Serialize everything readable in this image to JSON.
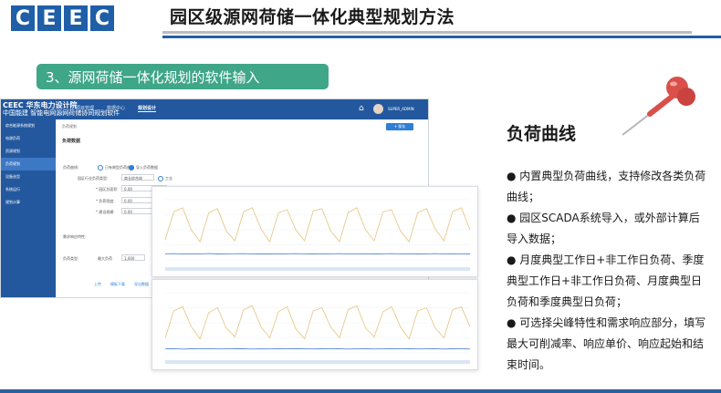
{
  "header": {
    "logo_letters": [
      "C",
      "E",
      "E",
      "C"
    ],
    "title": "园区级源网荷储一体化典型规划方法"
  },
  "section": {
    "label": "3、源网荷储一体化规划的软件输入"
  },
  "app": {
    "brand_line1": "CEEC 华东电力设计院",
    "brand_line2": "中国能建 智能电网源网荷储协同规划软件",
    "tabs": [
      "项目管理",
      "数据中心",
      "规划设计"
    ],
    "active_tab": 2,
    "user": "SUPER_ADMIN",
    "sidebar": [
      "综合能源系统规划",
      "电源负荷",
      "资源规划",
      "负荷规划",
      "设备选型",
      "系统运行",
      "规划计算"
    ],
    "active_sidebar": 3,
    "breadcrumb": "负荷规划",
    "action_button": "+ 保存",
    "panel_title": "负荷数据",
    "rows": [
      {
        "label": "负荷曲线:",
        "value": "已有典型负荷曲线",
        "value2": "导入负荷数据"
      },
      {
        "label": "园区行业负荷类型:",
        "value": "商业综合体",
        "value2": "工业"
      },
      {
        "label": "* 园区总面积:",
        "value": "0.00"
      },
      {
        "label": "* 负荷密度:",
        "value": "0.00"
      },
      {
        "label": "* 建设规模:",
        "value": "0.00"
      }
    ],
    "subsection1": "需求响应特性:",
    "subsection2": "负荷类型:",
    "max_label": "最大负荷",
    "max_value": "1,000",
    "links": [
      "上传",
      "模板下载",
      "导出数据"
    ]
  },
  "bullets": {
    "title": "负荷曲线",
    "items": [
      "内置典型负荷曲线，支持修改各类负荷曲线；",
      "园区SCADA系统导入，或外部计算后导入数据；",
      "月度典型工作日+非工作日负荷、季度典型工作日+非工作日负荷、月度典型日负荷和季度典型日负荷；",
      "可选择尖峰特性和需求响应部分，填写最大可削减率、响应单价、响应起始和结束时间。"
    ]
  },
  "colors": {
    "accent_blue": "#1f5fa8",
    "badge_green": "#3fa687",
    "curve_load": "#e8c98a",
    "curve_base": "#5b8bd6",
    "pin_red": "#d9504a"
  },
  "chart_data": [
    {
      "type": "line",
      "title": "",
      "series": [
        {
          "values": [
            200,
            480,
            520,
            300,
            180,
            470,
            510,
            290,
            190,
            480,
            520,
            310,
            180,
            470,
            500,
            300,
            190,
            490,
            510,
            290,
            180,
            470,
            520,
            300,
            190,
            480,
            500,
            290,
            180,
            470,
            510,
            310,
            190,
            480,
            520,
            300
          ]
        },
        {
          "values": [
            60,
            62,
            58,
            61,
            60,
            63,
            59,
            60,
            61,
            62,
            58,
            60,
            59,
            61,
            60,
            62,
            60,
            59,
            61,
            60,
            62,
            58,
            60,
            61,
            59,
            60,
            62,
            60,
            61,
            59,
            60,
            62,
            58,
            61,
            60,
            59
          ]
        }
      ],
      "ylim": [
        0,
        600
      ]
    },
    {
      "type": "line",
      "title": "",
      "series": [
        {
          "values": [
            150,
            420,
            460,
            260,
            140,
            400,
            450,
            250,
            160,
            430,
            470,
            260,
            150,
            410,
            460,
            240,
            140,
            420,
            450,
            260,
            150,
            430,
            470,
            250,
            160,
            410,
            460,
            260,
            140,
            420,
            450,
            250,
            150,
            430,
            460,
            260
          ]
        },
        {
          "values": [
            40,
            42,
            38,
            41,
            40,
            43,
            39,
            40,
            41,
            42,
            38,
            40,
            39,
            41,
            40,
            42,
            40,
            39,
            41,
            40,
            42,
            38,
            40,
            41,
            39,
            40,
            42,
            40,
            41,
            39,
            40,
            42,
            38,
            41,
            40,
            39
          ]
        }
      ],
      "ylim": [
        0,
        600
      ]
    }
  ]
}
